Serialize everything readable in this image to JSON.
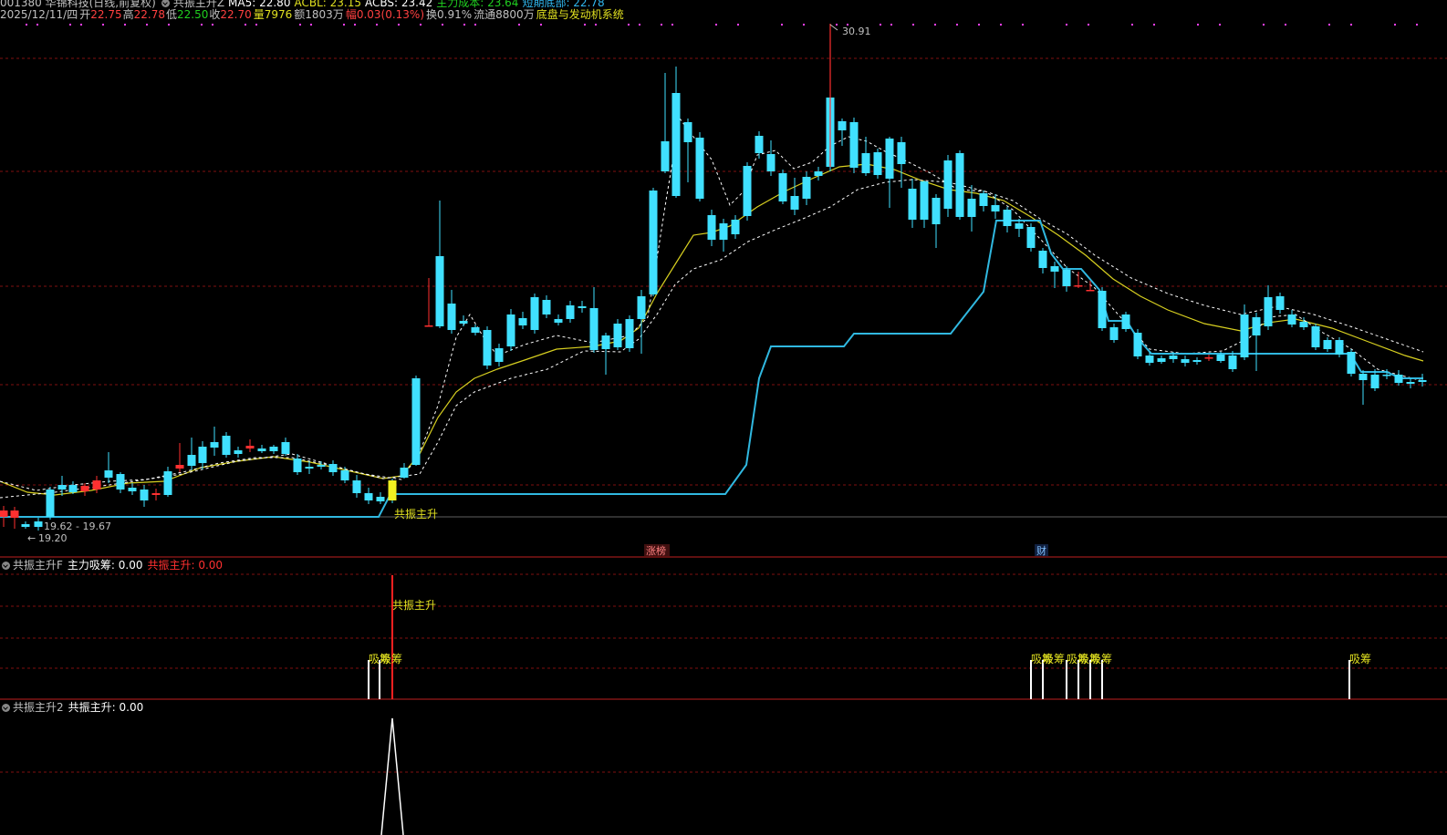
{
  "header": {
    "code_name": "001380 华锦科技(日线,前复权)",
    "indicator": "共振主升Z",
    "ma5": "MA5: 22.80",
    "acbl": "ACBL: 23.15",
    "acbs": "ACBS: 23.42",
    "main_cost": "主力成本: 23.64",
    "short_bottom": "短期底部: 22.78",
    "date": "2025/12/11/四",
    "open_label": "开",
    "open": "22.75",
    "high_label": "高",
    "high": "22.78",
    "low_label": "低",
    "low": "22.50",
    "close_label": "收",
    "close": "22.70",
    "volume": "量7976",
    "amount": "额1803万",
    "change": "幅0.03(0.13%)",
    "turnover": "换0.91%",
    "float": "流通8800万",
    "system": "底盘与发动机系统"
  },
  "main_pane": {
    "peak_label": "30.91",
    "range_label": "19.62 - 19.67",
    "low_label": "19.20",
    "signal_label": "共振主升",
    "zhangting_badge": "涨榜",
    "cai_badge": "财"
  },
  "pane2": {
    "name": "共振主升F",
    "v1": "主力吸筹: 0.00",
    "v2": "共振主升: 0.00",
    "signal_label": "共振主升",
    "xichou_labels": [
      "吸筹",
      "吸筹",
      "吸筹",
      "吸筹",
      "吸筹",
      "吸筹",
      "吸筹",
      "吸筹"
    ]
  },
  "pane3": {
    "name": "共振主升2",
    "v1": "共振主升: 0.00"
  },
  "colors": {
    "up": "#ff3030",
    "down": "#40e0ff",
    "ma": "#ffffff",
    "yellow": "#c8c820",
    "support": "#30b8e0",
    "grid": "#801010",
    "magenta": "#ff40ff"
  }
}
